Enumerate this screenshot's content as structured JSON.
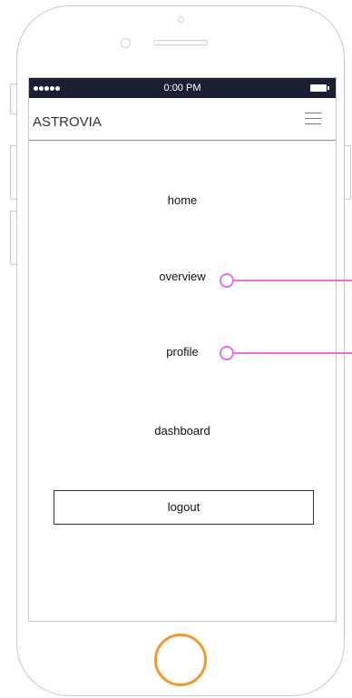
{
  "status_bar": {
    "time": "0:00 PM"
  },
  "app_bar": {
    "brand": "ASTROVIA",
    "menu_icon": "hamburger-icon"
  },
  "menu": {
    "items": [
      {
        "label": "home"
      },
      {
        "label": "overview"
      },
      {
        "label": "profile"
      },
      {
        "label": "dashboard"
      }
    ],
    "logout_label": "logout"
  },
  "colors": {
    "status_bar_bg": "#1b1f33",
    "annotation": "#e66ee6",
    "home_button": "#f29a2e"
  }
}
